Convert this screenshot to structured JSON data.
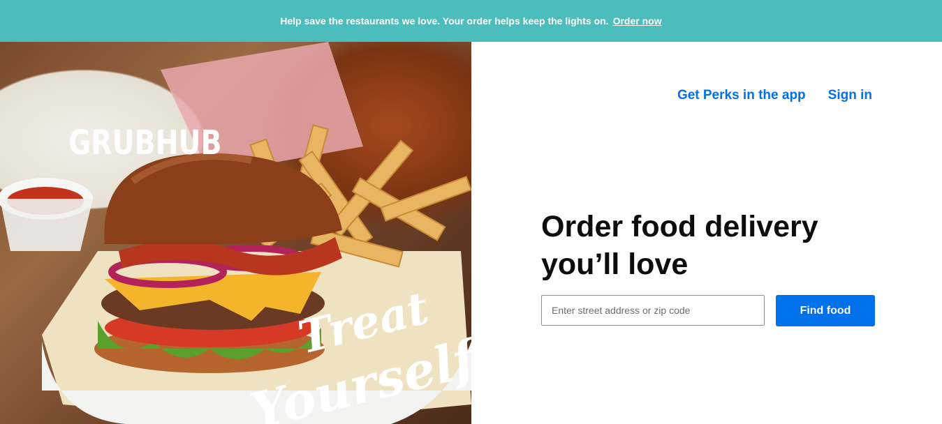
{
  "banner": {
    "message": "Help save the restaurants we love. Your order helps keep the lights on.",
    "link_label": "Order now"
  },
  "hero": {
    "logo_text": "GRUBHUB",
    "script_line1": "Treat",
    "script_line2": "Yourself"
  },
  "nav": {
    "perks_label": "Get Perks in the app",
    "signin_label": "Sign in"
  },
  "main": {
    "headline_line1": "Order food delivery",
    "headline_line2": "you’ll love",
    "search_placeholder": "Enter street address or zip code",
    "search_value": "",
    "find_label": "Find food"
  },
  "colors": {
    "banner": "#4bbdbc",
    "accent": "#0070eb"
  }
}
